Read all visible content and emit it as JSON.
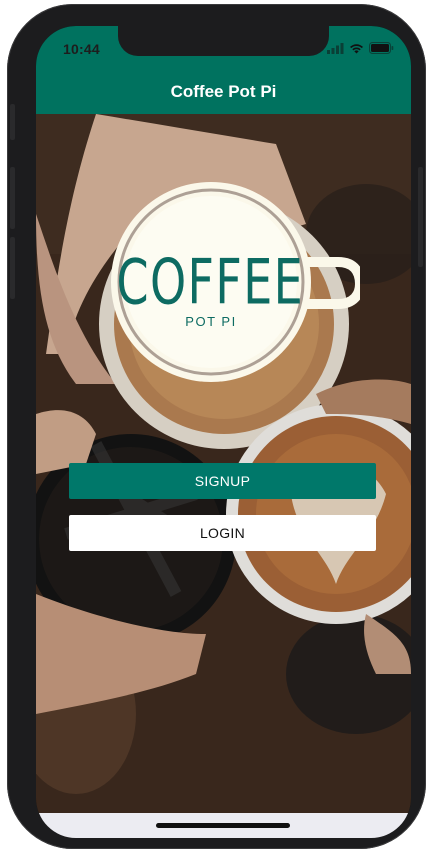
{
  "status_bar": {
    "time": "10:44"
  },
  "nav": {
    "title": "Coffee Pot Pi"
  },
  "logo": {
    "word": "COFFEE",
    "sub": "POT PI"
  },
  "buttons": {
    "signup": "SIGNUP",
    "login": "LOGIN"
  },
  "colors": {
    "brand": "#00725f",
    "button": "#00786a"
  },
  "icons": [
    "signal-icon",
    "wifi-icon",
    "battery-icon",
    "coffee-cup-logo-icon"
  ]
}
